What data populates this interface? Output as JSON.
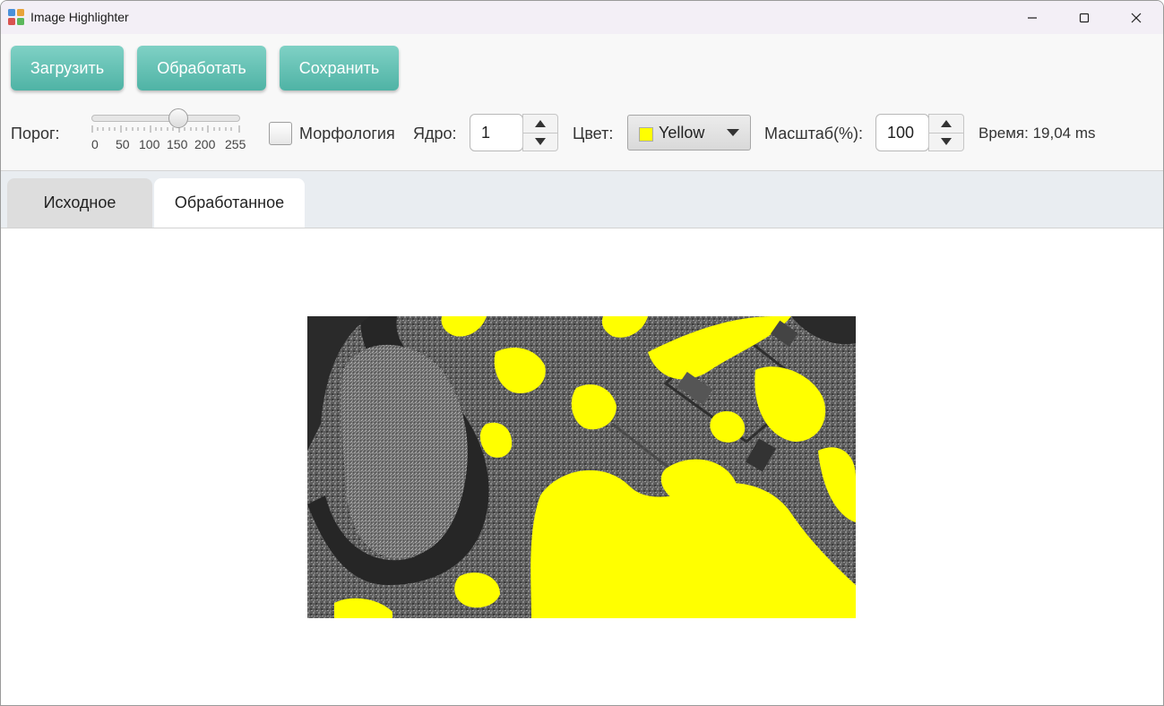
{
  "window": {
    "title": "Image Highlighter",
    "icon": "app-grid-icon"
  },
  "toolbar": {
    "load_label": "Загрузить",
    "process_label": "Обработать",
    "save_label": "Сохранить"
  },
  "controls": {
    "threshold_label": "Порог:",
    "threshold_value": 150,
    "threshold_ticks": [
      "0",
      "50",
      "100",
      "150",
      "200",
      "255"
    ],
    "morphology_label": "Морфология",
    "morphology_checked": false,
    "kernel_label": "Ядро:",
    "kernel_value": "1",
    "color_label": "Цвет:",
    "color_value": "Yellow",
    "color_hex": "#ffff00",
    "scale_label": "Масштаб(%):",
    "scale_value": "100",
    "time_text": "Время: 19,04 ms"
  },
  "tabs": [
    {
      "label": "Исходное",
      "active": false
    },
    {
      "label": "Обработанное",
      "active": true
    }
  ],
  "colors": {
    "accent": "#5bbdaf",
    "highlight": "#ffff00"
  }
}
